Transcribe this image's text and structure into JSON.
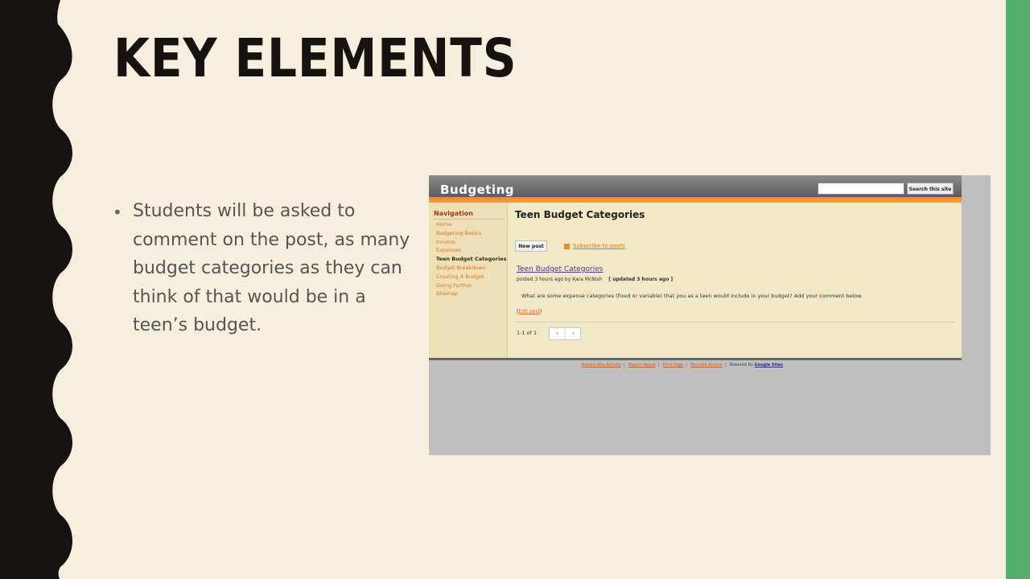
{
  "slide": {
    "title": "KEY ELEMENTS",
    "bullet": "Students will be asked to comment on the post, as many budget categories as they can think of that would be in a teen’s budget.",
    "accent_color": "#56ae6e",
    "wave_color": "#151210",
    "background_color": "#f6efde"
  },
  "site": {
    "title": "Budgeting",
    "search_value": "",
    "search_button": "Search this site",
    "nav_heading": "Navigation",
    "nav_items": [
      {
        "label": "Home"
      },
      {
        "label": "Budgeting Basics"
      },
      {
        "label": "Income"
      },
      {
        "label": "Expenses"
      },
      {
        "label": "Teen Budget Categories",
        "active": true
      },
      {
        "label": "Budget Breakdown"
      },
      {
        "label": "Creating A Budget"
      },
      {
        "label": "Going Further"
      },
      {
        "label": "Sitemap"
      }
    ],
    "page_title": "Teen Budget Categories",
    "new_post_button": "New post",
    "subscribe_link": "Subscribe to posts",
    "post": {
      "title": "Teen Budget Categories",
      "meta": "posted 3 hours ago by Kara McNish",
      "updated": "[ updated 3 hours ago ]",
      "body": "What are some expense categories (fixed or variable) that you as a teen would include in your budget? Add your comment below.",
      "edit_link": "Edit post"
    },
    "pager": {
      "count": "1-1 of 1",
      "prev_icon": "chevron-left-icon",
      "next_icon": "chevron-right-icon"
    },
    "footer": {
      "links": [
        "Recent Site Activity",
        "Report Abuse",
        "Print Page",
        "Remove Access"
      ],
      "powered_by": "Powered By",
      "google_sites": "Google Sites"
    },
    "colors": {
      "orange": "#f08a1c",
      "link_orange": "#e3711f",
      "header_gray": "#6e6e6e",
      "content_bg": "#f1e8c6"
    }
  }
}
